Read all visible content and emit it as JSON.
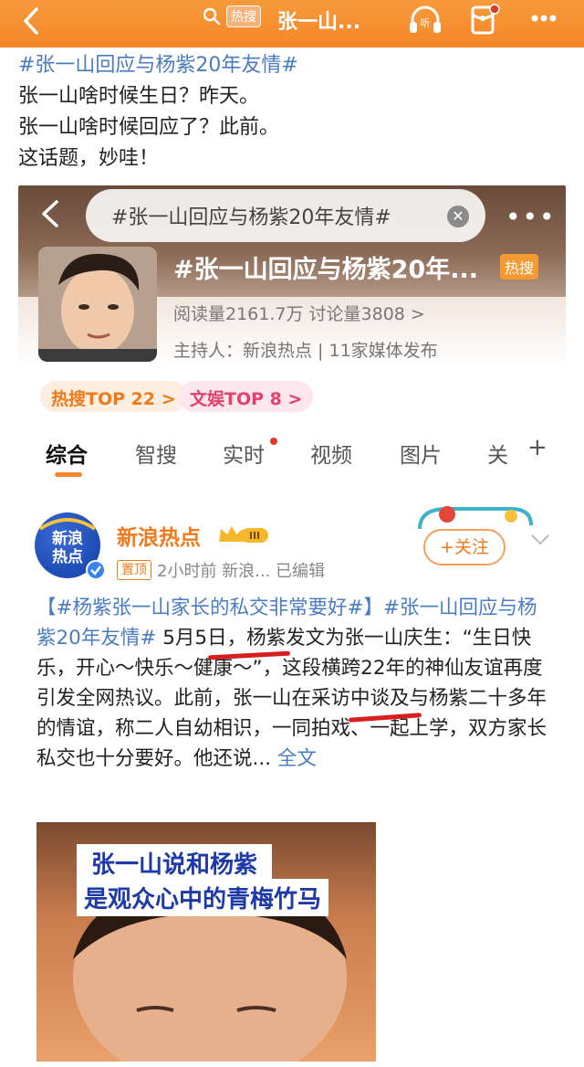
{
  "topbar": {
    "hot_label": "热搜",
    "title": "张一山...",
    "listen_icon": "headphones-icon",
    "redpacket_icon": "red-envelope-icon",
    "more": "···"
  },
  "post": {
    "hashtag": "#张一山回应与杨紫20年友情#",
    "lines": [
      "张一山啥时候生日？昨天。",
      "张一山啥时候回应了？此前。",
      "这话题，妙哇！"
    ]
  },
  "embed": {
    "search_text": "#张一山回应与杨紫20年友情#",
    "title": "#张一山回应与杨紫20年...",
    "hot_tag": "热搜",
    "stats": "阅读量2161.7万  讨论量3808",
    "stats_arrow": ">",
    "host": "主持人：新浪热点 | 11家媒体发布",
    "badges": [
      "热搜TOP 22 >",
      "文娱TOP 8 >"
    ],
    "tabs": [
      "综合",
      "智搜",
      "实时",
      "视频",
      "图片",
      "关"
    ],
    "plus": "+"
  },
  "card": {
    "account_name": "新浪热点",
    "avatar_text": "新浪\n热点",
    "level": "III",
    "pin_label": "置顶",
    "meta": "2小时前  新浪...  已编辑",
    "follow_label": "+关注",
    "body": {
      "tag1": "【#杨紫张一山家长的私交非常要好#】",
      "tag2": "#张一山回应与杨紫20年友情#",
      "seg1": " 5月5日，杨紫发文为张一山庆生：“生日快乐，开心～快乐～健康～”，这段横跨22年的神仙友谊再度引发全网热议。此前，张一山在采访中谈及与杨紫二十多年的情谊，称二人自幼相识，一同拍戏、一起上学，双方家长私交也十分要好。他还说...",
      "full_text": "全文"
    },
    "video": {
      "caption_line1": "张一山说和杨紫",
      "caption_line2": "是观众心中的青梅竹马"
    }
  },
  "colors": {
    "accent_orange": "#f5862a",
    "link_blue": "#4a7cc2",
    "underline_red": "#d81e1e"
  }
}
